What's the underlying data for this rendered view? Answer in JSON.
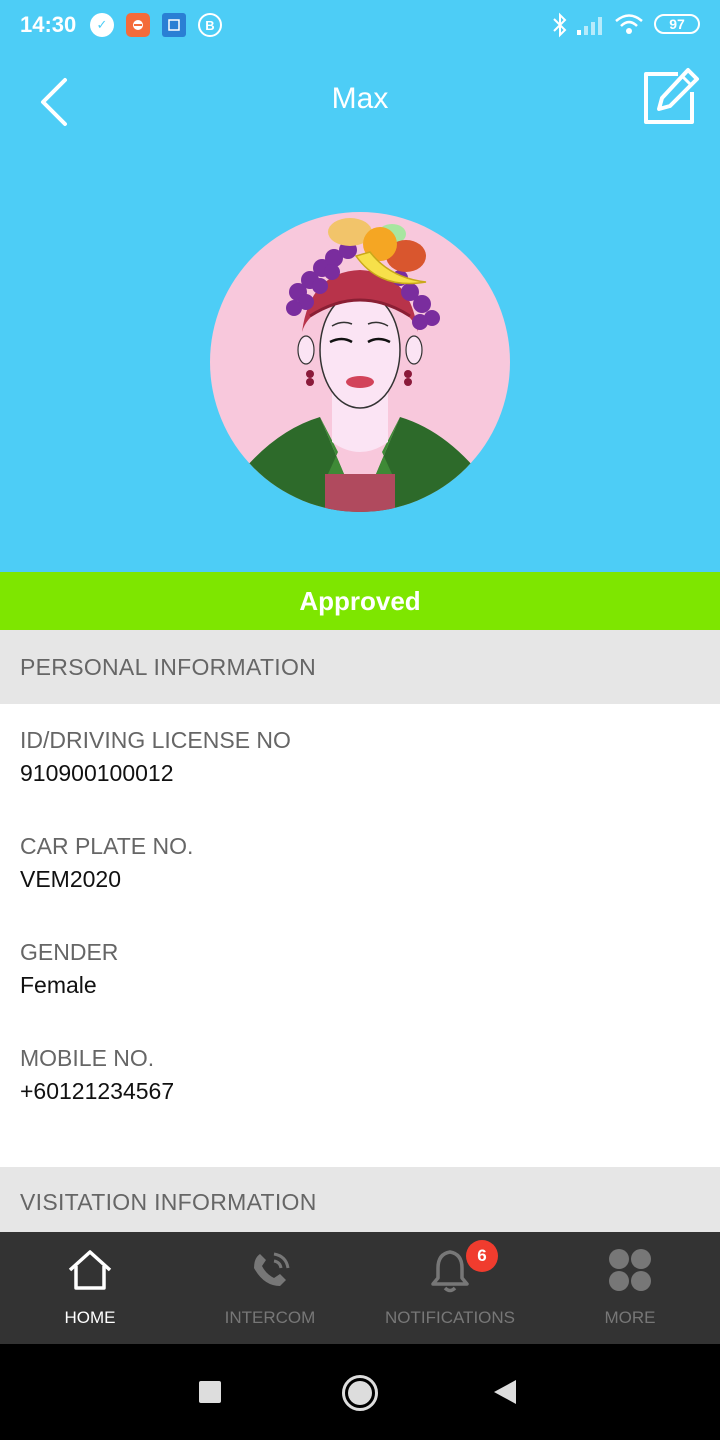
{
  "status_bar": {
    "time": "14:30",
    "battery": "97",
    "icons": [
      "check-circle-icon",
      "app-notification-icon",
      "app-square-icon",
      "whatsapp-business-icon",
      "bluetooth-icon",
      "signal-icon",
      "wifi-icon",
      "battery-icon"
    ]
  },
  "header": {
    "title": "Max",
    "back_icon": "chevron-left-icon",
    "edit_icon": "edit-icon"
  },
  "profile": {
    "status": "Approved",
    "status_color": "#7ee600",
    "accent_color": "#4dcdf6"
  },
  "personal_section": {
    "title": "PERSONAL INFORMATION",
    "fields": [
      {
        "label": "ID/DRIVING LICENSE NO",
        "value": "910900100012"
      },
      {
        "label": "CAR PLATE NO.",
        "value": "VEM2020"
      },
      {
        "label": "GENDER",
        "value": "Female"
      },
      {
        "label": "MOBILE NO.",
        "value": "+60121234567"
      }
    ]
  },
  "visitation_section": {
    "title": "VISITATION INFORMATION"
  },
  "bottom_nav": {
    "items": [
      {
        "label": "HOME",
        "icon": "home-icon",
        "active": true
      },
      {
        "label": "INTERCOM",
        "icon": "phone-icon",
        "active": false
      },
      {
        "label": "NOTIFICATIONS",
        "icon": "bell-icon",
        "active": false,
        "badge": "6"
      },
      {
        "label": "MORE",
        "icon": "more-grid-icon",
        "active": false
      }
    ]
  },
  "system_nav": {
    "icons": [
      "recents-square-icon",
      "home-circle-icon",
      "back-triangle-icon"
    ]
  }
}
